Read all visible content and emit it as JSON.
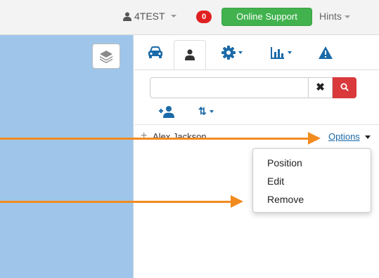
{
  "topbar": {
    "username": "4TEST",
    "notification_count": "0",
    "support_label": "Online Support",
    "hints_label": "Hints"
  },
  "tabs": [
    {
      "name": "vehicles",
      "icon": "car-icon",
      "active": false
    },
    {
      "name": "people",
      "icon": "user-icon",
      "active": true
    },
    {
      "name": "settings",
      "icon": "gear-icon",
      "active": false
    },
    {
      "name": "reports",
      "icon": "bar-chart-icon",
      "active": false
    },
    {
      "name": "alerts",
      "icon": "warning-icon",
      "active": false
    }
  ],
  "search": {
    "value": "",
    "placeholder": "",
    "clear_label": "✖"
  },
  "sort_label": "⇅",
  "people": [
    {
      "plus": "+",
      "name": "Alex Jackson",
      "options_label": "Options"
    }
  ],
  "options_menu": [
    "Position",
    "Edit",
    "Remove"
  ],
  "colors": {
    "map": "#9fc6ea",
    "support": "#41b24e",
    "badge": "#e02020",
    "search_button": "#d9393b",
    "link": "#1a6aa8",
    "annotation_arrow": "#f28b1f"
  }
}
